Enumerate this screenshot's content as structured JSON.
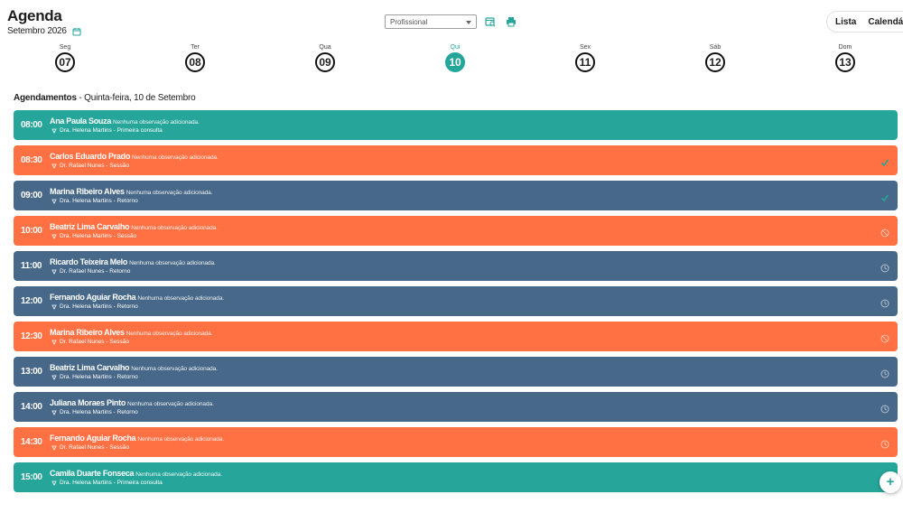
{
  "header": {
    "title": "Agenda",
    "month": "Setembro 2026",
    "professional_select": "Profissional",
    "view_toggle": {
      "list": "Lista",
      "calendar": "Calendário"
    }
  },
  "colors": {
    "accent": "#26a69a",
    "orange": "#ff7043",
    "slate": "#476888",
    "teal": "#26a69a"
  },
  "week": [
    {
      "name": "Seg",
      "num": "07",
      "active": false
    },
    {
      "name": "Ter",
      "num": "08",
      "active": false
    },
    {
      "name": "Qua",
      "num": "09",
      "active": false
    },
    {
      "name": "Qui",
      "num": "10",
      "active": true
    },
    {
      "name": "Sex",
      "num": "11",
      "active": false
    },
    {
      "name": "Sáb",
      "num": "12",
      "active": false
    },
    {
      "name": "Dom",
      "num": "13",
      "active": false
    }
  ],
  "section": {
    "label": "Agendamentos",
    "date": " - Quinta-feira, 10 de Setembro"
  },
  "appointments": [
    {
      "time": "08:00",
      "patient": "Ana Paula Souza",
      "note": "Nenhuma observação adicionada.",
      "meta": "Dra. Helena Martins - Primeira consulta",
      "color": "teal",
      "status": "none"
    },
    {
      "time": "08:30",
      "patient": "Carlos Eduardo Prado",
      "note": "Nenhuma observação adicionada.",
      "meta": "Dr. Rafael Nunes - Sessão",
      "color": "orange",
      "status": "check"
    },
    {
      "time": "09:00",
      "patient": "Marina Ribeiro Alves",
      "note": "Nenhuma observação adicionada.",
      "meta": "Dra. Helena Martins - Retorno",
      "color": "slate",
      "status": "check"
    },
    {
      "time": "10:00",
      "patient": "Beatriz Lima Carvalho",
      "note": "Nenhuma observação adicionada.",
      "meta": "Dra. Helena Martins - Sessão",
      "color": "orange",
      "status": "cancel"
    },
    {
      "time": "11:00",
      "patient": "Ricardo Teixeira Melo",
      "note": "Nenhuma observação adicionada.",
      "meta": "Dr. Rafael Nunes - Retorno",
      "color": "slate",
      "status": "clock"
    },
    {
      "time": "12:00",
      "patient": "Fernando Aguiar Rocha",
      "note": "Nenhuma observação adicionada.",
      "meta": "Dra. Helena Martins - Retorno",
      "color": "slate",
      "status": "clock"
    },
    {
      "time": "12:30",
      "patient": "Marina Ribeiro Alves",
      "note": "Nenhuma observação adicionada.",
      "meta": "Dr. Rafael Nunes - Sessão",
      "color": "orange",
      "status": "cancel"
    },
    {
      "time": "13:00",
      "patient": "Beatriz Lima Carvalho",
      "note": "Nenhuma observação adicionada.",
      "meta": "Dra. Helena Martins - Retorno",
      "color": "slate",
      "status": "clock"
    },
    {
      "time": "14:00",
      "patient": "Juliana Moraes Pinto",
      "note": "Nenhuma observação adicionada.",
      "meta": "Dra. Helena Martins - Retorno",
      "color": "slate",
      "status": "clock"
    },
    {
      "time": "14:30",
      "patient": "Fernando Aguiar Rocha",
      "note": "Nenhuma observação adicionada.",
      "meta": "Dr. Rafael Nunes - Sessão",
      "color": "orange",
      "status": "clock"
    },
    {
      "time": "15:00",
      "patient": "Camila Duarte Fonseca",
      "note": "Nenhuma observação adicionada.",
      "meta": "Dra. Helena Martins - Primeira consulta",
      "color": "teal",
      "status": "none"
    }
  ],
  "fab": {
    "label": "+"
  }
}
